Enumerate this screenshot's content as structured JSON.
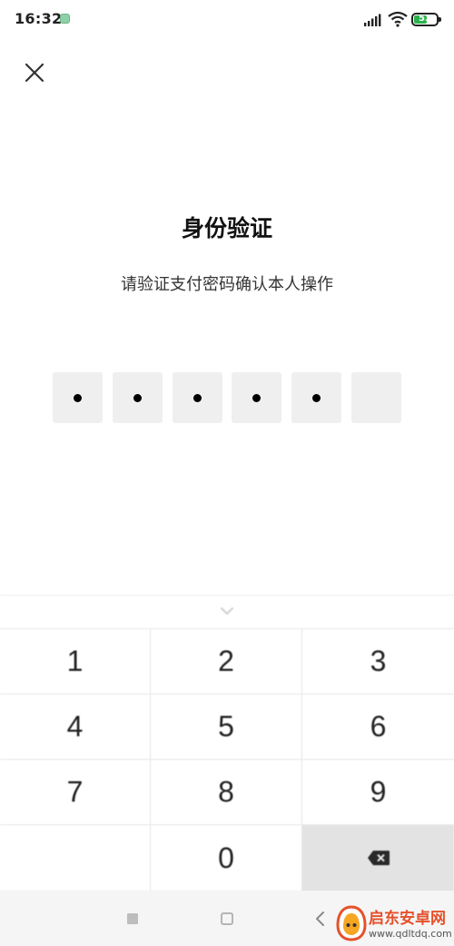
{
  "status_bar": {
    "time": "16:32",
    "battery": "53"
  },
  "dialog": {
    "title": "身份验证",
    "subtitle": "请验证支付密码确认本人操作"
  },
  "pin": {
    "length": 6,
    "filled": 5
  },
  "keypad": {
    "keys": [
      "1",
      "2",
      "3",
      "4",
      "5",
      "6",
      "7",
      "8",
      "9",
      "",
      "0",
      "delete"
    ]
  },
  "watermark": {
    "title": "启东安卓网",
    "url": "www.qdltdq.com"
  },
  "colors": {
    "battery_fill": "#2bb24c",
    "delete_key_bg": "#e3e3e3",
    "pin_box_bg": "#efefef",
    "watermark_accent": "#e6502a"
  }
}
